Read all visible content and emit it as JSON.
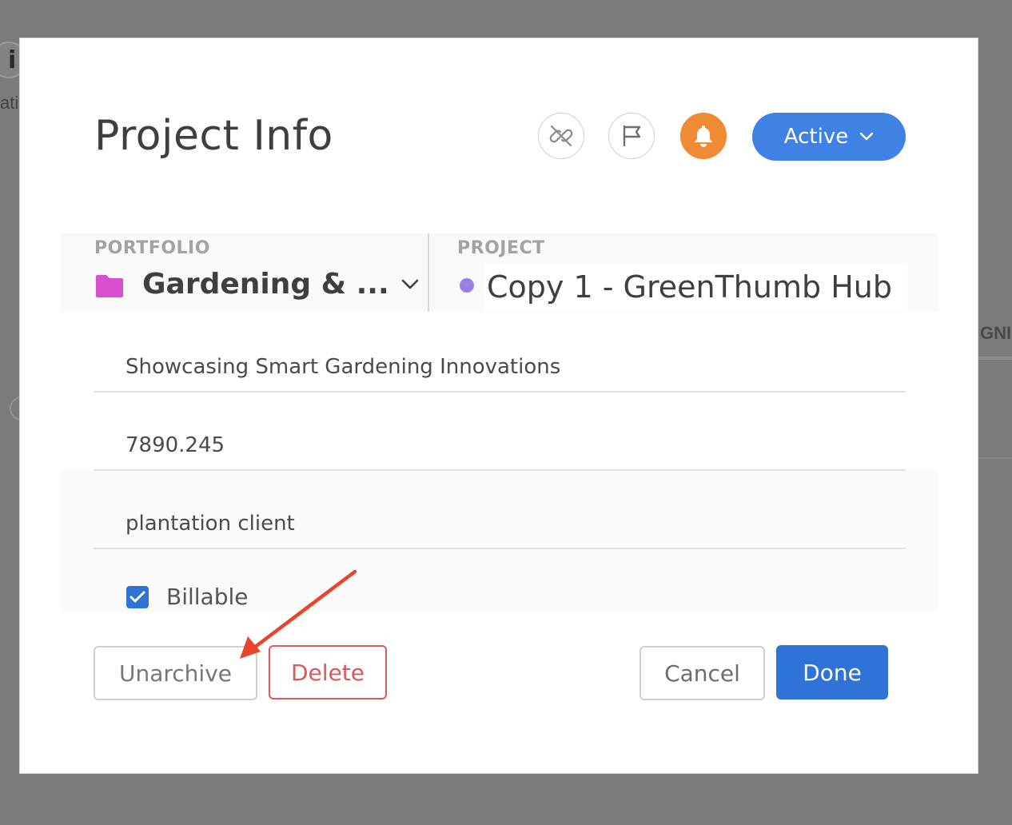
{
  "background": {
    "side_text": "ati",
    "right_text": "GNI"
  },
  "modal": {
    "title": "Project Info",
    "header_icons": {
      "unlink": "unlink-icon",
      "flag": "flag-icon",
      "bell": "bell-icon"
    },
    "status": {
      "label": "Active",
      "color": "#3f82e4"
    },
    "portfolio": {
      "label": "PORTFOLIO",
      "value": "Gardening & ...",
      "folder_color": "#d94fcf"
    },
    "project": {
      "label": "PROJECT",
      "value": "Copy 1 - GreenThumb Hub",
      "dot_color": "#9b7fe6"
    },
    "fields": {
      "description": "Showcasing Smart Gardening Innovations",
      "budget": "7890.245",
      "client": "plantation client"
    },
    "billable": {
      "label": "Billable",
      "checked": true
    },
    "buttons": {
      "unarchive": "Unarchive",
      "delete": "Delete",
      "cancel": "Cancel",
      "done": "Done"
    }
  },
  "annotation": {
    "arrow_color": "#e8452c"
  }
}
